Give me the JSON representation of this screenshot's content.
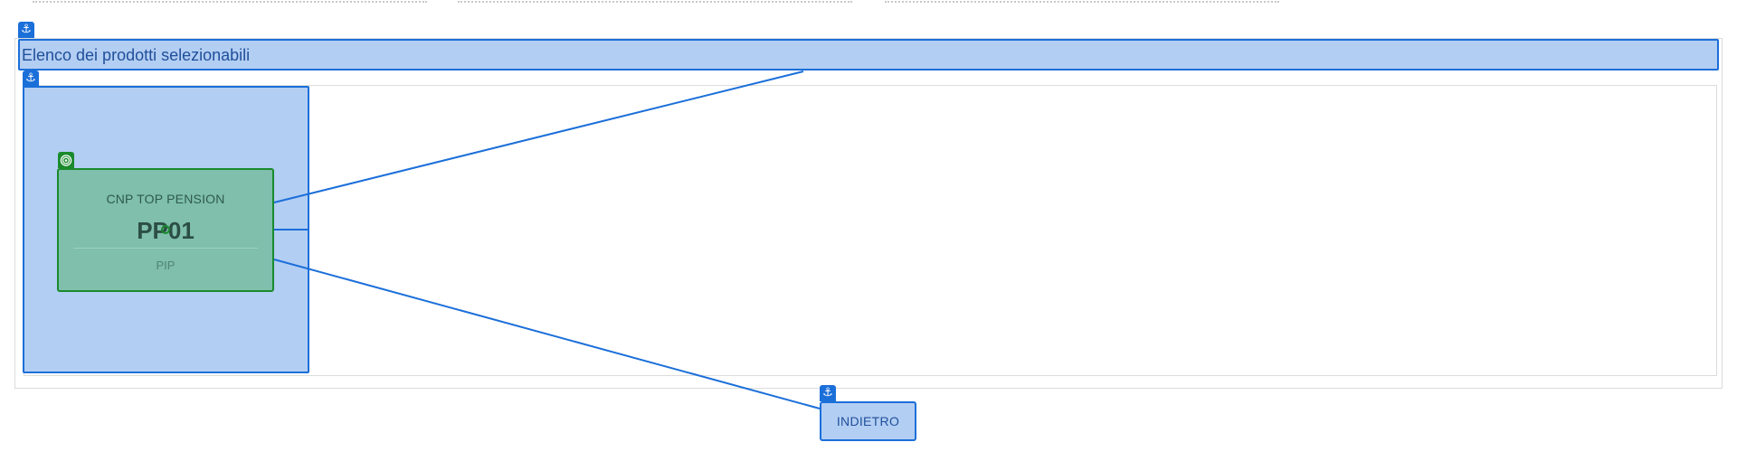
{
  "header": {
    "title": "Elenco dei prodotti selezionabili",
    "anchor_icon": "anchor-icon"
  },
  "product_list": {
    "anchor_icon": "anchor-icon",
    "items": [
      {
        "company": "CNP TOP PENSION",
        "code": "PP01",
        "type": "PIP",
        "icon": "target-icon"
      }
    ]
  },
  "footer": {
    "back_label": "INDIETRO",
    "anchor_icon": "anchor-icon"
  },
  "colors": {
    "accent": "#1b6fd9",
    "panel_fill": "#b3cef3",
    "card_fill": "#7fbfab",
    "card_border": "#1a8a2c"
  }
}
